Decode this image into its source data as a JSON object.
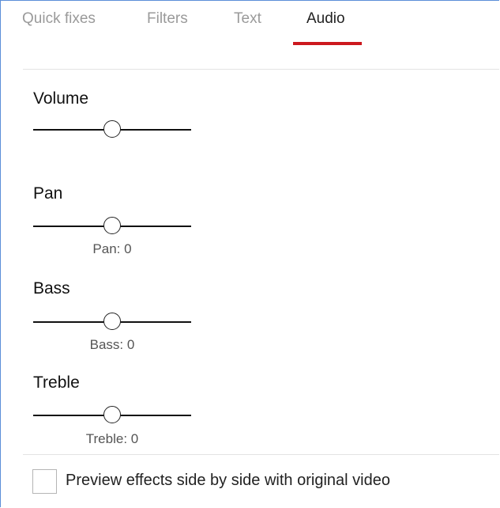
{
  "tabs": [
    {
      "label": "Quick fixes",
      "active": false
    },
    {
      "label": "Filters",
      "active": false
    },
    {
      "label": "Text",
      "active": false
    },
    {
      "label": "Audio",
      "active": true
    }
  ],
  "accent_color": "#cc181e",
  "audio": {
    "volume": {
      "title": "Volume",
      "level": 0.5
    },
    "pan": {
      "title": "Pan",
      "level": 0.5,
      "value_text": "Pan: 0"
    },
    "bass": {
      "title": "Bass",
      "level": 0.5,
      "value_text": "Bass: 0"
    },
    "treble": {
      "title": "Treble",
      "level": 0.5,
      "value_text": "Treble: 0"
    }
  },
  "preview": {
    "label": "Preview effects side by side with original video",
    "checked": false
  }
}
